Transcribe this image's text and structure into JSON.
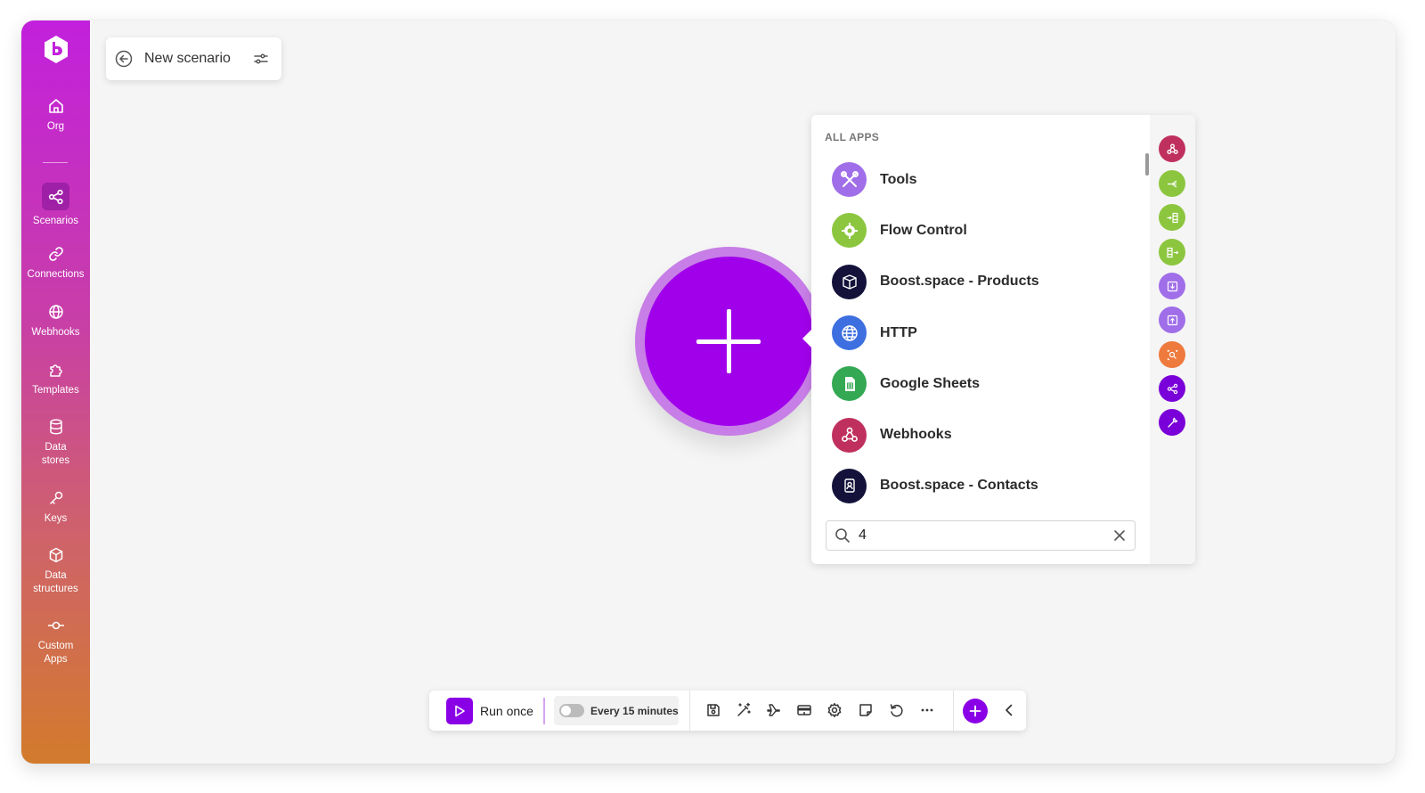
{
  "sidebar": {
    "logo": "boost-space-logo",
    "items": [
      {
        "label": "Org",
        "icon": "home-icon"
      },
      {
        "label": "Scenarios",
        "icon": "share-nodes-icon",
        "active": true
      },
      {
        "label": "Connections",
        "icon": "link-icon"
      },
      {
        "label": "Webhooks",
        "icon": "globe-icon"
      },
      {
        "label": "Templates",
        "icon": "puzzle-icon"
      },
      {
        "label": "Data stores",
        "icon": "database-icon"
      },
      {
        "label": "Keys",
        "icon": "key-icon"
      },
      {
        "label": "Data structures",
        "icon": "cube-icon"
      },
      {
        "label": "Custom Apps",
        "icon": "commit-icon"
      }
    ]
  },
  "header": {
    "title": "New scenario"
  },
  "app_picker": {
    "heading": "ALL APPS",
    "apps": [
      {
        "name": "Tools",
        "icon": "tools-icon",
        "color": "#a06ee8"
      },
      {
        "name": "Flow Control",
        "icon": "gear-icon",
        "color": "#8cc63f"
      },
      {
        "name": "Boost.space - Products",
        "icon": "box-icon",
        "color": "#14123a"
      },
      {
        "name": "HTTP",
        "icon": "globe-icon",
        "color": "#3d6fe0"
      },
      {
        "name": "Google Sheets",
        "icon": "sheets-icon",
        "color": "#34a853"
      },
      {
        "name": "Webhooks",
        "icon": "webhook-icon",
        "color": "#c0305e"
      },
      {
        "name": "Boost.space - Contacts",
        "icon": "contact-icon",
        "color": "#14123a"
      }
    ],
    "quick_icons": [
      {
        "icon": "webhook-icon",
        "color": "#c0305e"
      },
      {
        "icon": "router-icon",
        "color": "#8cc63f"
      },
      {
        "icon": "aggregator-in-icon",
        "color": "#8cc63f"
      },
      {
        "icon": "iterator-out-icon",
        "color": "#8cc63f"
      },
      {
        "icon": "download-icon",
        "color": "#a06ee8"
      },
      {
        "icon": "upload-icon",
        "color": "#a06ee8"
      },
      {
        "icon": "search-record-icon",
        "color": "#ef7a3d"
      },
      {
        "icon": "share-icon",
        "color": "#7a00d9"
      },
      {
        "icon": "tools-icon",
        "color": "#7a00d9"
      }
    ],
    "search": {
      "value": "4",
      "placeholder": ""
    }
  },
  "toolbar": {
    "run_label": "Run once",
    "schedule_label": "Every 15 minutes",
    "schedule_enabled": false,
    "icons": [
      "save-icon",
      "magic-wand-icon",
      "plane-icon",
      "card-icon",
      "settings-icon",
      "note-icon",
      "undo-icon",
      "more-icon"
    ]
  },
  "colors": {
    "accent": "#a100ea",
    "ring": "#c77ee6"
  }
}
